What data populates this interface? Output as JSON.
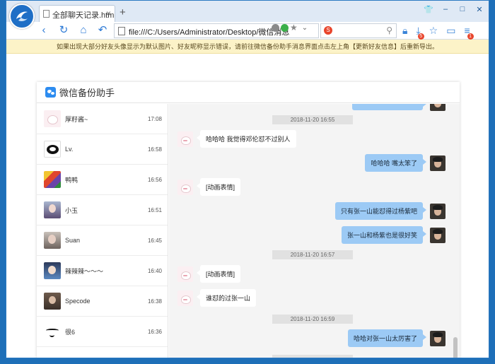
{
  "browser": {
    "tab_title": "全部聊天记录.html",
    "tab_close": "×",
    "new_tab": "+",
    "address": "file:///C:/Users/Administrator/Desktop/微信消息",
    "search_badge": "S",
    "download_badge": "5",
    "menu_badge": "1",
    "win_controls": [
      "👕",
      "–",
      "□",
      "✕"
    ]
  },
  "notice": "如果出现大部分好友头像显示为默认图片、好友昵称显示错误，请前往微信备份助手消息界面点击左上角【更新好友信息】后重新导出。",
  "app": {
    "title": "微信备份助手"
  },
  "contacts": [
    {
      "name": "厚籽酱~",
      "time": "17:08"
    },
    {
      "name": "Lv.",
      "time": "16:58"
    },
    {
      "name": "鸭鸭",
      "time": "16:56"
    },
    {
      "name": "小玉",
      "time": "16:51"
    },
    {
      "name": "Suan",
      "time": "16:45"
    },
    {
      "name": "辣辣辣～～～",
      "time": "16:40"
    },
    {
      "name": "Specode",
      "time": "16:38"
    },
    {
      "name": "很6",
      "time": "16:36"
    }
  ],
  "chat": {
    "timestamps": [
      "2018-11-20 16:55",
      "2018-11-20 16:57",
      "2018-11-20 16:59"
    ],
    "messages": [
      {
        "side": "in",
        "text": "哈哈哈 我觉得邓伦怼不过别人"
      },
      {
        "side": "out",
        "text": "哈哈哈 嘴太笨了"
      },
      {
        "side": "in",
        "text": "[动画表情]"
      },
      {
        "side": "out",
        "text": "只有张一山能怼得过杨紫吧"
      },
      {
        "side": "out",
        "text": "张一山和杨紫也是很好笑"
      },
      {
        "side": "in",
        "text": "[动画表情]"
      },
      {
        "side": "in",
        "text": "谁怼的过张一山"
      },
      {
        "side": "out",
        "text": "哈哈对张一山太厉害了"
      }
    ]
  }
}
